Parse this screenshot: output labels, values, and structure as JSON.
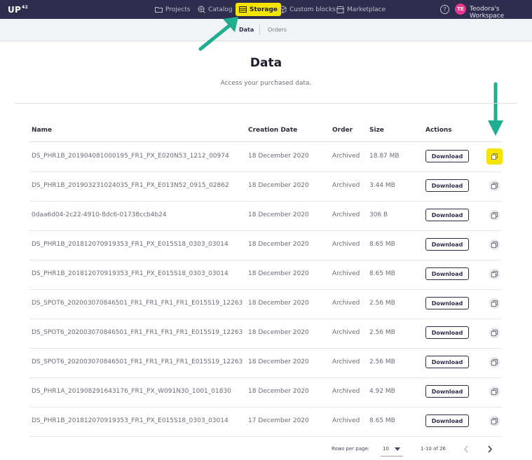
{
  "app": {
    "logo": "UP",
    "logo_sup": "42"
  },
  "topnav": {
    "projects": "Projects",
    "catalog": "Catalog",
    "storage": "Storage",
    "custom_blocks": "Custom blocks",
    "marketplace": "Marketplace",
    "help": "?",
    "avatar_initials": "TE",
    "workspace": "Teodora's Workspace"
  },
  "subtabs": {
    "data": "Data",
    "orders": "Orders"
  },
  "page": {
    "title": "Data",
    "subtitle": "Access your purchased data."
  },
  "table": {
    "headers": {
      "name": "Name",
      "date": "Creation Date",
      "order": "Order",
      "size": "Size",
      "actions": "Actions"
    },
    "download_label": "Download",
    "rows": [
      {
        "name": "DS_PHR1B_201904081000195_FR1_PX_E020N53_1212_00974",
        "date": "18 December 2020",
        "order": "Archived",
        "size": "18.87 MB"
      },
      {
        "name": "DS_PHR1B_201903231024035_FR1_PX_E013N52_0915_02862",
        "date": "18 December 2020",
        "order": "Archived",
        "size": "3.44 MB"
      },
      {
        "name": "0daa6d04-2c22-4910-8dc6-01738ccb4b24",
        "date": "18 December 2020",
        "order": "Archived",
        "size": "306 B"
      },
      {
        "name": "DS_PHR1B_201812070919353_FR1_PX_E015S18_0303_03014",
        "date": "18 December 2020",
        "order": "Archived",
        "size": "8.65 MB"
      },
      {
        "name": "DS_PHR1B_201812070919353_FR1_PX_E015S18_0303_03014",
        "date": "18 December 2020",
        "order": "Archived",
        "size": "8.65 MB"
      },
      {
        "name": "DS_SPOT6_202003070846501_FR1_FR1_FR1_FR1_E015S19_12263",
        "date": "18 December 2020",
        "order": "Archived",
        "size": "2.56 MB"
      },
      {
        "name": "DS_SPOT6_202003070846501_FR1_FR1_FR1_FR1_E015S19_12263",
        "date": "18 December 2020",
        "order": "Archived",
        "size": "2.56 MB"
      },
      {
        "name": "DS_SPOT6_202003070846501_FR1_FR1_FR1_FR1_E015S19_12263",
        "date": "18 December 2020",
        "order": "Archived",
        "size": "2.56 MB"
      },
      {
        "name": "DS_PHR1A_201908291643176_FR1_PX_W091N30_1001_01830",
        "date": "18 December 2020",
        "order": "Archived",
        "size": "4.92 MB"
      },
      {
        "name": "DS_PHR1B_201812070919353_FR1_PX_E015S18_0303_03014",
        "date": "17 December 2020",
        "order": "Archived",
        "size": "8.65 MB"
      }
    ]
  },
  "pagination": {
    "rows_per_page_label": "Rows per page:",
    "rows_per_page": "10",
    "range": "1-10 of 26"
  },
  "colors": {
    "nav_bg": "#2e2d4d",
    "highlight": "#f5e400",
    "annotation_arrow": "#1fae8f",
    "avatar": "#e8368f"
  }
}
